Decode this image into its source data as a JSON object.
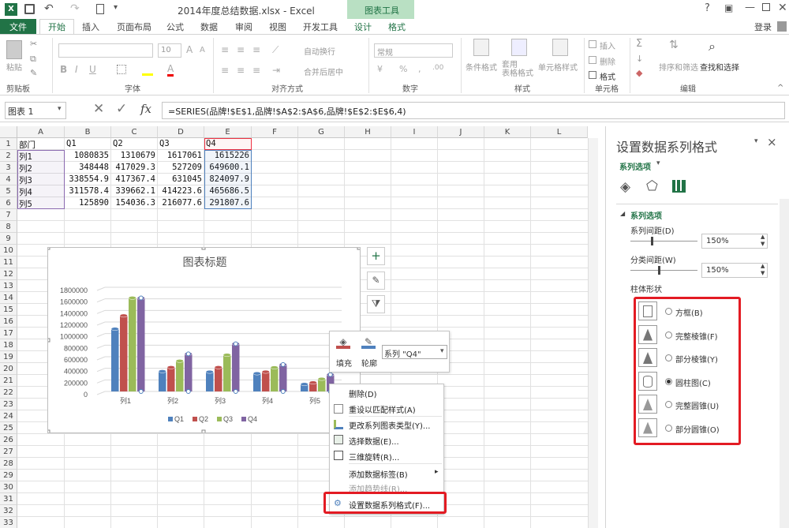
{
  "window": {
    "title": "2014年度总结数据.xlsx - Excel",
    "context_tab": "图表工具",
    "user": "登录"
  },
  "tabs": [
    "文件",
    "开始",
    "插入",
    "页面布局",
    "公式",
    "数据",
    "审阅",
    "视图",
    "开发工具",
    "设计",
    "格式"
  ],
  "ribbon": {
    "groups": [
      "剪贴板",
      "字体",
      "对齐方式",
      "数字",
      "样式",
      "单元格",
      "编辑"
    ],
    "paste": "粘贴",
    "font_size": "10",
    "wrap": "自动换行",
    "merge": "合并后居中",
    "numfmt": "常规",
    "cond": "条件格式",
    "table_fmt": "套用\n表格格式",
    "cell_style": "单元格样式",
    "insert": "插入",
    "delete": "删除",
    "format": "格式",
    "sort": "排序和筛选",
    "find": "查找和选择"
  },
  "formula_bar": {
    "name_box": "图表 1",
    "fx": "fx",
    "formula": "=SERIES(品牌!$E$1,品牌!$A$2:$A$6,品牌!$E$2:$E$6,4)"
  },
  "columns": [
    "A",
    "B",
    "C",
    "D",
    "E",
    "F",
    "G",
    "H",
    "I",
    "J",
    "K",
    "L"
  ],
  "rows": [
    "1",
    "2",
    "3",
    "4",
    "5",
    "6",
    "7",
    "8",
    "9",
    "10",
    "11",
    "12",
    "13",
    "14",
    "15",
    "16",
    "17",
    "18",
    "19",
    "20",
    "21",
    "22",
    "23",
    "24",
    "25",
    "26",
    "27",
    "28",
    "29",
    "30",
    "31",
    "32",
    "33"
  ],
  "cells": {
    "header": [
      "部门",
      "Q1",
      "Q2",
      "Q3",
      "Q4"
    ],
    "data": [
      [
        "列1",
        "1080835",
        "1310679",
        "1617061",
        "1615226"
      ],
      [
        "列2",
        "348448",
        "417029.3",
        "527209",
        "649600.1"
      ],
      [
        "列3",
        "338554.9",
        "417367.4",
        "631045",
        "824097.9"
      ],
      [
        "列4",
        "311578.4",
        "339662.1",
        "414223.6",
        "465686.5"
      ],
      [
        "列5",
        "125890",
        "154036.3",
        "216077.6",
        "291807.6"
      ]
    ]
  },
  "chart_data": {
    "type": "bar",
    "title": "图表标题",
    "categories": [
      "列1",
      "列2",
      "列3",
      "列4",
      "列5"
    ],
    "series": [
      {
        "name": "Q1",
        "color": "#4f81bd",
        "values": [
          1080835,
          348448,
          338554.9,
          311578.4,
          125890
        ]
      },
      {
        "name": "Q2",
        "color": "#c0504d",
        "values": [
          1310679,
          417029.3,
          417367.4,
          339662.1,
          154036.3
        ]
      },
      {
        "name": "Q3",
        "color": "#9bbb59",
        "values": [
          1617061,
          527209,
          631045,
          414223.6,
          216077.6
        ]
      },
      {
        "name": "Q4",
        "color": "#8064a2",
        "values": [
          1615226,
          649600.1,
          824097.9,
          465686.5,
          291807.6
        ]
      }
    ],
    "yticks": [
      "1800000",
      "1600000",
      "1400000",
      "1200000",
      "1000000",
      "800000",
      "600000",
      "400000",
      "200000",
      "0"
    ],
    "ylim": [
      0,
      1800000
    ],
    "grid": true,
    "legend": "bottom",
    "shape": "cylinder"
  },
  "format_box": {
    "fill": "填充",
    "outline": "轮廓",
    "series_select": "系列 \"Q4\""
  },
  "context_menu": [
    {
      "label": "删除(D)",
      "enabled": true
    },
    {
      "label": "重设以匹配样式(A)",
      "enabled": true
    },
    {
      "label": "更改系列图表类型(Y)...",
      "enabled": true
    },
    {
      "label": "选择数据(E)...",
      "enabled": true
    },
    {
      "label": "三维旋转(R)...",
      "enabled": true
    },
    {
      "label": "添加数据标签(B)",
      "enabled": true
    },
    {
      "label": "添加趋势线(R)...",
      "enabled": false
    },
    {
      "label": "设置数据系列格式(F)...",
      "enabled": true
    }
  ],
  "pane": {
    "title": "设置数据系列格式",
    "close": "×",
    "dropdown": "系列选项",
    "section": "系列选项",
    "gap_depth_label": "系列间距(D)",
    "gap_depth": "150%",
    "gap_width_label": "分类间距(W)",
    "gap_width": "150%",
    "shape_label": "柱体形状",
    "shapes": [
      {
        "label": "方框(B)",
        "checked": false
      },
      {
        "label": "完整棱锥(F)",
        "checked": false
      },
      {
        "label": "部分棱锥(Y)",
        "checked": false
      },
      {
        "label": "圆柱图(C)",
        "checked": true
      },
      {
        "label": "完整圆锥(U)",
        "checked": false
      },
      {
        "label": "部分圆锥(O)",
        "checked": false
      }
    ]
  },
  "colors": {
    "excel_green": "#217346",
    "highlight": "#e31b23"
  }
}
